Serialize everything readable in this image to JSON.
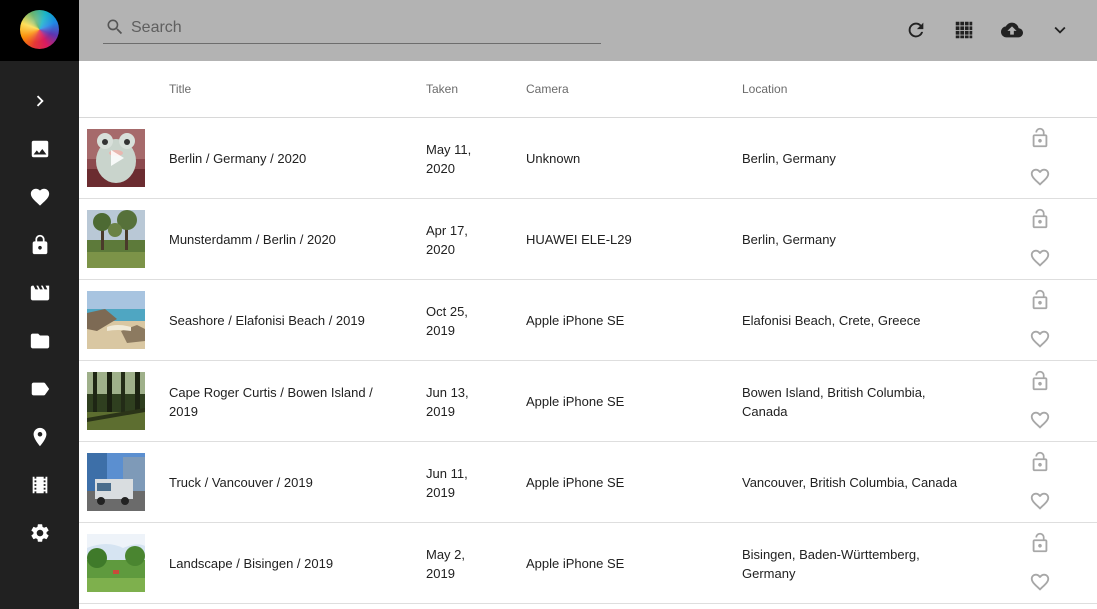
{
  "toolbar": {
    "search_placeholder": "Search",
    "icons": [
      "refresh-icon",
      "grid-view-icon",
      "upload-icon",
      "chevron-down-icon"
    ]
  },
  "sidebar": {
    "items": [
      {
        "name": "expand",
        "icon": "chevron-right-icon"
      },
      {
        "name": "photos",
        "icon": "photo-icon"
      },
      {
        "name": "favorites",
        "icon": "heart-icon"
      },
      {
        "name": "private",
        "icon": "lock-icon"
      },
      {
        "name": "videos",
        "icon": "movie-icon"
      },
      {
        "name": "folders",
        "icon": "folder-icon"
      },
      {
        "name": "labels",
        "icon": "label-icon"
      },
      {
        "name": "places",
        "icon": "location-icon"
      },
      {
        "name": "library",
        "icon": "film-library-icon"
      },
      {
        "name": "settings",
        "icon": "gear-icon"
      }
    ]
  },
  "table": {
    "headers": {
      "title": "Title",
      "taken": "Taken",
      "camera": "Camera",
      "location": "Location"
    },
    "rows": [
      {
        "title": "Berlin / Germany / 2020",
        "taken_line1": "May 11,",
        "taken_line2": "2020",
        "camera": "Unknown",
        "location": "Berlin, Germany",
        "video": true
      },
      {
        "title": "Munsterdamm / Berlin / 2020",
        "taken_line1": "Apr 17,",
        "taken_line2": "2020",
        "camera": "HUAWEI ELE-L29",
        "location": "Berlin, Germany",
        "video": false
      },
      {
        "title": "Seashore / Elafonisi Beach / 2019",
        "taken_line1": "Oct 25,",
        "taken_line2": "2019",
        "camera": "Apple iPhone SE",
        "location": "Elafonisi Beach, Crete, Greece",
        "video": false
      },
      {
        "title": "Cape Roger Curtis / Bowen Island / 2019",
        "taken_line1": "Jun 13,",
        "taken_line2": "2019",
        "camera": "Apple iPhone SE",
        "location": "Bowen Island, British Columbia, Canada",
        "video": false
      },
      {
        "title": "Truck / Vancouver / 2019",
        "taken_line1": "Jun 11,",
        "taken_line2": "2019",
        "camera": "Apple iPhone SE",
        "location": "Vancouver, British Columbia, Canada",
        "video": false
      },
      {
        "title": "Landscape / Bisingen / 2019",
        "taken_line1": "May 2,",
        "taken_line2": "2019",
        "camera": "Apple iPhone SE",
        "location": "Bisingen, Baden-Württemberg, Germany",
        "video": false
      }
    ]
  },
  "colors": {
    "sidebar_bg": "#212121",
    "toolbar_bg": "#b3b3b3",
    "action_icon": "#a7a7a7"
  }
}
